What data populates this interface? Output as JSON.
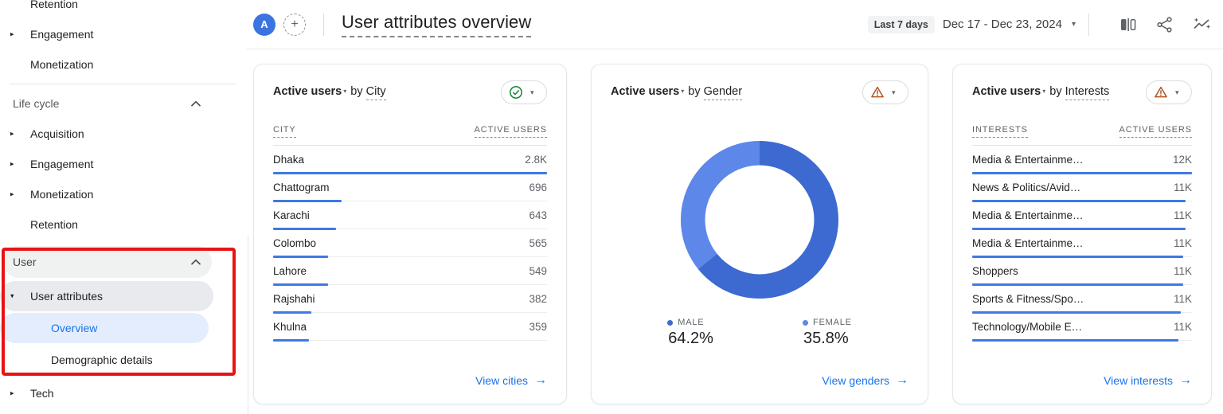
{
  "icons": {
    "caret_right": "▸",
    "caret_down": "▾",
    "plus": "+",
    "arrow_right": "→",
    "avatar_letter": "A"
  },
  "sidebar": {
    "top_items": [
      {
        "label": "Retention"
      },
      {
        "label": "Engagement"
      },
      {
        "label": "Monetization"
      }
    ],
    "lifecycle_header": "Life cycle",
    "lifecycle_items": [
      {
        "label": "Acquisition"
      },
      {
        "label": "Engagement"
      },
      {
        "label": "Monetization"
      },
      {
        "label": "Retention"
      }
    ],
    "user_header": "User",
    "user_attributes_label": "User attributes",
    "user_children": [
      {
        "label": "Overview",
        "active": true
      },
      {
        "label": "Demographic details",
        "active": false
      }
    ],
    "tech_label": "Tech"
  },
  "header": {
    "title": "User attributes overview",
    "date_badge": "Last 7 days",
    "date_range": "Dec 17 - Dec 23, 2024"
  },
  "cards": {
    "city": {
      "metric": "Active users",
      "by": "by",
      "dimension": "City",
      "col1": "CITY",
      "col2": "ACTIVE USERS",
      "rows": [
        {
          "name": "Dhaka",
          "value": "2.8K",
          "bar": "100%"
        },
        {
          "name": "Chattogram",
          "value": "696",
          "bar": "25%"
        },
        {
          "name": "Karachi",
          "value": "643",
          "bar": "23%"
        },
        {
          "name": "Colombo",
          "value": "565",
          "bar": "20%"
        },
        {
          "name": "Lahore",
          "value": "549",
          "bar": "20%"
        },
        {
          "name": "Rajshahi",
          "value": "382",
          "bar": "14%"
        },
        {
          "name": "Khulna",
          "value": "359",
          "bar": "13%"
        }
      ],
      "footer_link": "View cities"
    },
    "gender": {
      "metric": "Active users",
      "by": "by",
      "dimension": "Gender",
      "male_label": "MALE",
      "male_pct": "64.2%",
      "female_label": "FEMALE",
      "female_pct": "35.8%",
      "male_color": "#3c6ad0",
      "female_color": "#5d87e8",
      "donut": {
        "slices": [
          {
            "pct": 64.2,
            "color": "#3c6ad0"
          },
          {
            "pct": 35.8,
            "color": "#5d87e8"
          }
        ]
      },
      "footer_link": "View genders"
    },
    "interests": {
      "metric": "Active users",
      "by": "by",
      "dimension": "Interests",
      "col1": "INTERESTS",
      "col2": "ACTIVE USERS",
      "rows": [
        {
          "name": "Media & Entertainme…",
          "value": "12K",
          "bar": "100%"
        },
        {
          "name": "News & Politics/Avid…",
          "value": "11K",
          "bar": "97%"
        },
        {
          "name": "Media & Entertainme…",
          "value": "11K",
          "bar": "97%"
        },
        {
          "name": "Media & Entertainme…",
          "value": "11K",
          "bar": "96%"
        },
        {
          "name": "Shoppers",
          "value": "11K",
          "bar": "96%"
        },
        {
          "name": "Sports & Fitness/Spo…",
          "value": "11K",
          "bar": "95%"
        },
        {
          "name": "Technology/Mobile E…",
          "value": "11K",
          "bar": "94%"
        }
      ],
      "footer_link": "View interests"
    }
  },
  "chart_data": [
    {
      "type": "table",
      "title": "Active users by City",
      "columns": [
        "CITY",
        "ACTIVE USERS"
      ],
      "categories": [
        "Dhaka",
        "Chattogram",
        "Karachi",
        "Colombo",
        "Lahore",
        "Rajshahi",
        "Khulna"
      ],
      "values": [
        2800,
        696,
        643,
        565,
        549,
        382,
        359
      ]
    },
    {
      "type": "pie",
      "title": "Active users by Gender",
      "labels": [
        "MALE",
        "FEMALE"
      ],
      "values": [
        64.2,
        35.8
      ],
      "unit": "%",
      "colors": [
        "#3c6ad0",
        "#5d87e8"
      ],
      "legend_position": "bottom"
    },
    {
      "type": "table",
      "title": "Active users by Interests",
      "columns": [
        "INTERESTS",
        "ACTIVE USERS"
      ],
      "categories": [
        "Media & Entertainme…",
        "News & Politics/Avid…",
        "Media & Entertainme…",
        "Media & Entertainme…",
        "Shoppers",
        "Sports & Fitness/Spo…",
        "Technology/Mobile E…"
      ],
      "values": [
        12000,
        11000,
        11000,
        11000,
        11000,
        11000,
        11000
      ]
    }
  ]
}
